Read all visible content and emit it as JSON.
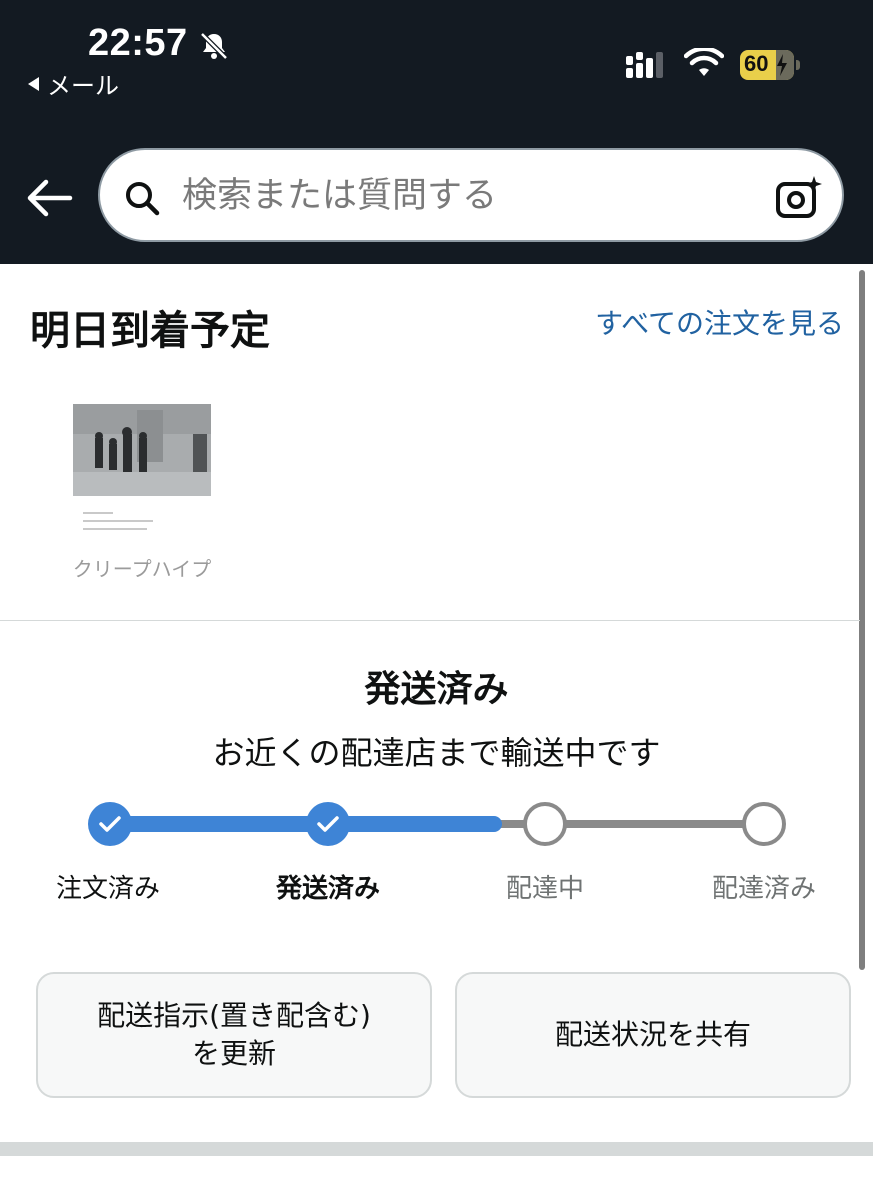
{
  "status_bar": {
    "time": "22:57",
    "back_app": "メール",
    "battery": "60",
    "icons": [
      "bell-off-icon",
      "signal-icon",
      "wifi-icon",
      "battery-charging-icon"
    ]
  },
  "nav": {
    "back_icon": "back-arrow-icon",
    "search_placeholder": "検索または質問する",
    "search_icon": "search-icon",
    "camera_icon": "camera-sparkle-icon"
  },
  "delivery": {
    "heading": "明日到着予定",
    "all_orders_link": "すべての注文を見る",
    "product_image_text": "クリープハイプ"
  },
  "status": {
    "title": "発送済み",
    "subtitle": "お近くの配達店まで輸送中です",
    "progress_completed": 2,
    "steps": [
      {
        "label": "注文済み",
        "state": "done"
      },
      {
        "label": "発送済み",
        "state": "current"
      },
      {
        "label": "配達中",
        "state": "todo"
      },
      {
        "label": "配達済み",
        "state": "todo"
      }
    ]
  },
  "actions": {
    "update_instructions_line1": "配送指示(置き配含む)",
    "update_instructions_line2": "を更新",
    "share_status": "配送状況を共有"
  },
  "colors": {
    "header_bg": "#131a22",
    "accent_blue": "#3e84d6",
    "link": "#2162a1",
    "battery": "#e9cf4a"
  }
}
